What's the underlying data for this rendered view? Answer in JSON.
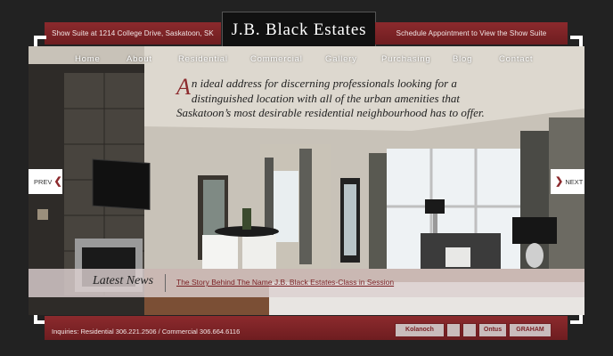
{
  "header": {
    "left_text": "Show Suite at 1214 College Drive, Saskatoon, SK",
    "logo_text": "J.B. Black Estates",
    "right_text": "Schedule Appointment to View the Show Suite"
  },
  "nav": {
    "items": [
      "Home",
      "About",
      "Residential",
      "Commercial",
      "Gallery",
      "Purchasing",
      "Blog",
      "Contact"
    ]
  },
  "hero": {
    "tagline_initial": "A",
    "tagline_rest": "n ideal address for discerning professionals looking for a distinguished location with all of the urban amenities that Saskatoon’s most desirable residential neighbourhood has to offer.",
    "prev_label": "PREV",
    "next_label": "NEXT"
  },
  "news": {
    "label": "Latest News",
    "link_text": "The Story Behind The Name J.B. Black Estates-Class in Session"
  },
  "footer": {
    "inquiries": "Inquiries: Residential 306.221.2506  /  Commercial 306.664.6116",
    "partners": [
      "Kolanoch",
      "",
      "Ontus",
      "GRAHAM"
    ]
  },
  "colors": {
    "accent": "#8c2a2d",
    "background": "#222222"
  }
}
